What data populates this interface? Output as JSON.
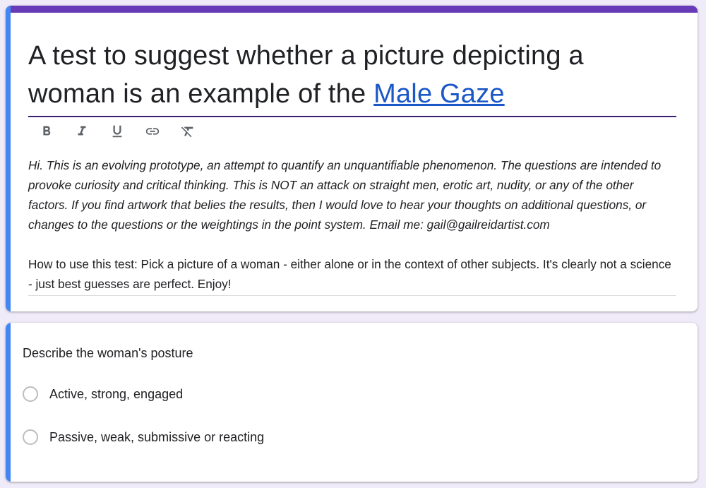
{
  "colors": {
    "theme": "#673ab7",
    "accent_bar": "#4285f4",
    "link": "#1a57c7",
    "background": "#f0ebf8"
  },
  "header": {
    "title_prefix": "A test to suggest whether a picture depicting a woman is an example of the ",
    "title_link": "Male Gaze",
    "toolbar": [
      {
        "name": "bold",
        "icon": "bold-icon"
      },
      {
        "name": "italic",
        "icon": "italic-icon"
      },
      {
        "name": "underline",
        "icon": "underline-icon"
      },
      {
        "name": "link",
        "icon": "link-icon"
      },
      {
        "name": "clear-formatting",
        "icon": "clear-formatting-icon"
      }
    ],
    "description_italic": "Hi. This is an evolving prototype, an attempt to quantify an unquantifiable phenomenon. The questions are intended to provoke curiosity and critical thinking. This is NOT an attack on straight men, erotic art, nudity, or any of the other factors. If you find artwork that belies the results, then I would love to hear your thoughts on additional questions, or changes to the questions or the weightings in the point system. Email me: gail@gailreidartist.com",
    "description_normal": "How to use this test: Pick a picture of a woman - either alone or in the context of other subjects. It's clearly not a science - just best guesses are perfect. Enjoy!"
  },
  "question": {
    "title": "Describe the woman's posture",
    "options": [
      "Active, strong, engaged",
      "Passive, weak, submissive or reacting"
    ]
  }
}
